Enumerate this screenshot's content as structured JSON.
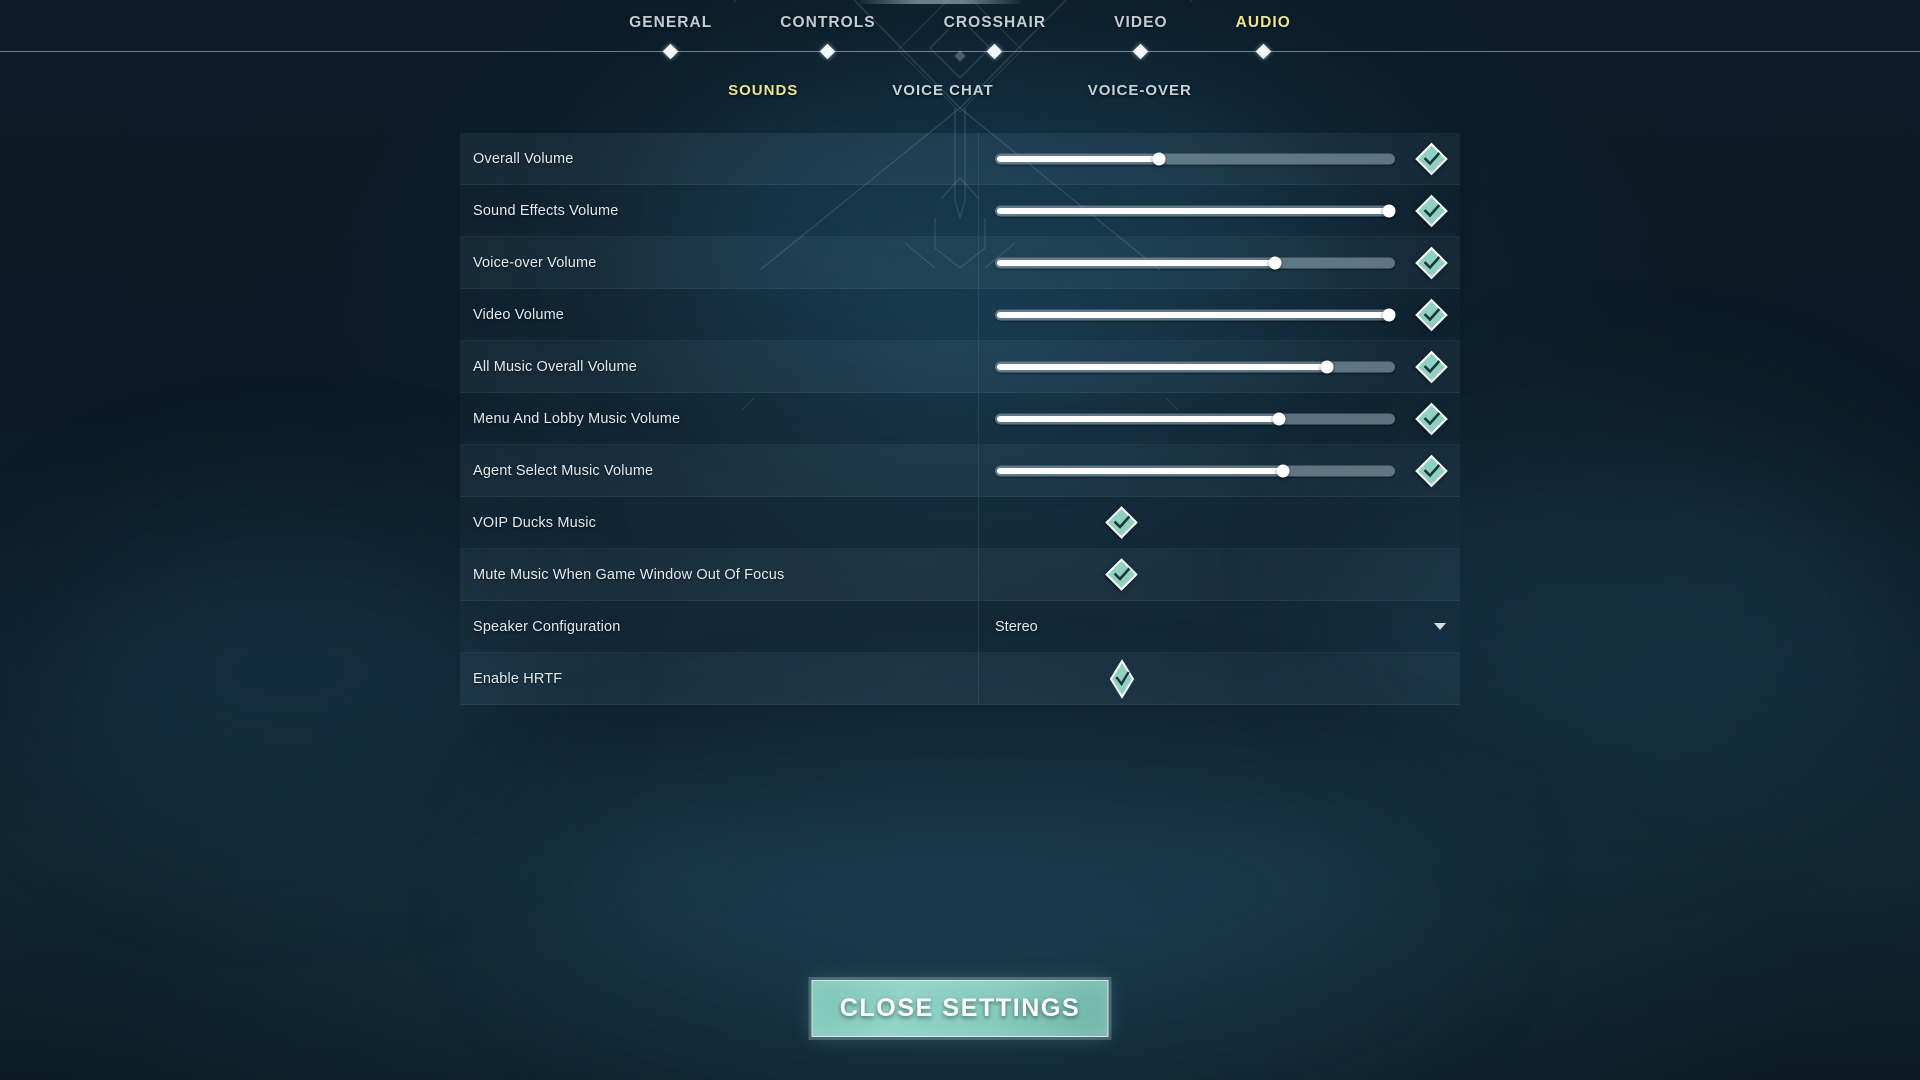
{
  "nav": {
    "main_tabs": [
      {
        "label": "GENERAL",
        "active": false
      },
      {
        "label": "CONTROLS",
        "active": false
      },
      {
        "label": "CROSSHAIR",
        "active": false
      },
      {
        "label": "VIDEO",
        "active": false
      },
      {
        "label": "AUDIO",
        "active": true
      }
    ],
    "sub_tabs": [
      {
        "label": "SOUNDS",
        "active": true
      },
      {
        "label": "VOICE CHAT",
        "active": false
      },
      {
        "label": "VOICE-OVER",
        "active": false
      }
    ]
  },
  "settings": {
    "rows": [
      {
        "label": "Overall Volume",
        "type": "slider",
        "value": 41,
        "has_reset": true
      },
      {
        "label": "Sound Effects Volume",
        "type": "slider",
        "value": 100,
        "has_reset": true
      },
      {
        "label": "Voice-over Volume",
        "type": "slider",
        "value": 70,
        "has_reset": true
      },
      {
        "label": "Video Volume",
        "type": "slider",
        "value": 100,
        "has_reset": true
      },
      {
        "label": "All Music Overall Volume",
        "type": "slider",
        "value": 83,
        "has_reset": true
      },
      {
        "label": "Menu And Lobby Music Volume",
        "type": "slider",
        "value": 71,
        "has_reset": true
      },
      {
        "label": "Agent Select Music Volume",
        "type": "slider",
        "value": 72,
        "has_reset": true
      },
      {
        "label": "VOIP Ducks Music",
        "type": "checkbox",
        "checked": true
      },
      {
        "label": "Mute Music When Game Window Out Of Focus",
        "type": "checkbox",
        "checked": true
      },
      {
        "label": "Speaker Configuration",
        "type": "dropdown",
        "value": "Stereo"
      },
      {
        "label": "Enable HRTF",
        "type": "checkbox-tall",
        "checked": true
      }
    ]
  },
  "footer": {
    "close_label": "CLOSE SETTINGS"
  },
  "icons": {
    "reset_diamond": "diamond-check-icon",
    "checkbox_diamond": "diamond-check-icon",
    "dropdown_caret": "chevron-down-icon",
    "nav_marker": "diamond-marker-icon"
  },
  "colors": {
    "accent_yellow": "#ece88a",
    "accent_teal": "#8fd0bf",
    "text_primary": "#e3eaee",
    "background": "#0c1b27"
  }
}
